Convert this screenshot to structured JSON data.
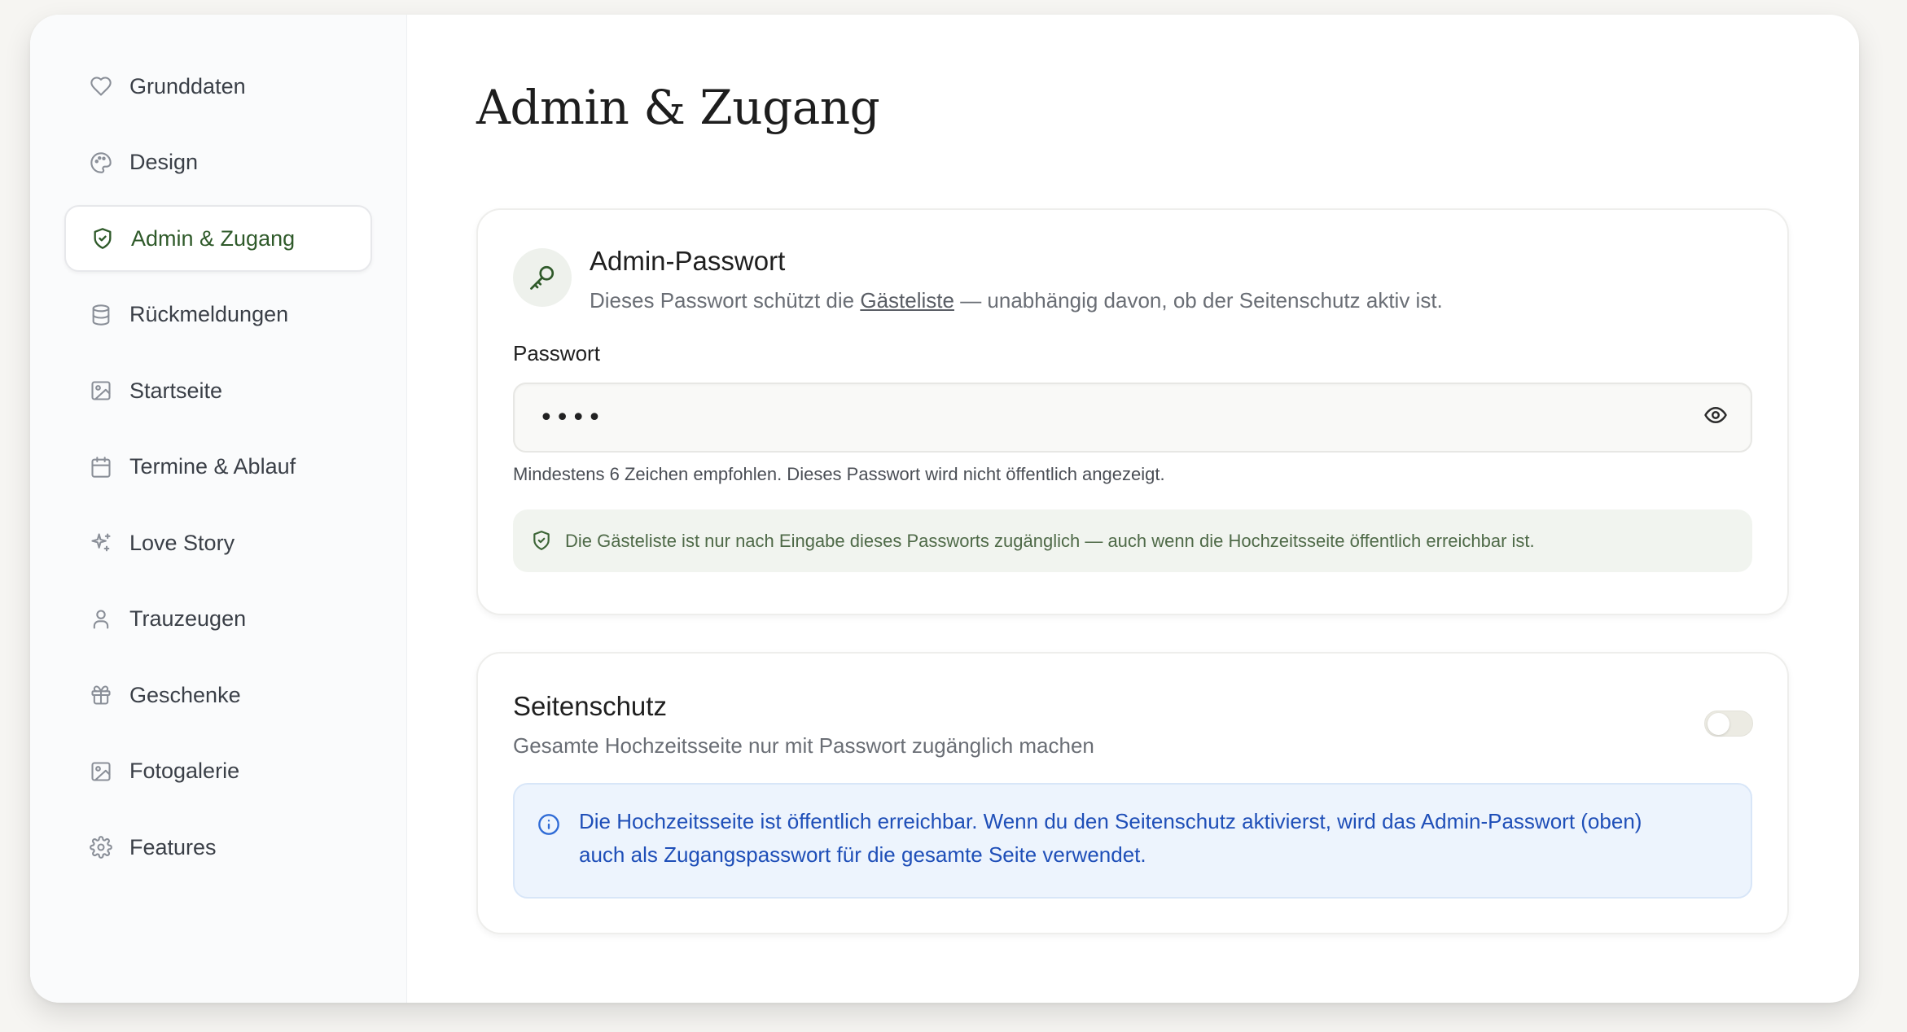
{
  "sidebar": {
    "items": [
      {
        "label": "Grunddaten",
        "icon": "heart-icon"
      },
      {
        "label": "Design",
        "icon": "palette-icon"
      },
      {
        "label": "Admin & Zugang",
        "icon": "shield-check-icon",
        "active": true
      },
      {
        "label": "Rückmeldungen",
        "icon": "database-icon"
      },
      {
        "label": "Startseite",
        "icon": "image-icon"
      },
      {
        "label": "Termine & Ablauf",
        "icon": "calendar-icon"
      },
      {
        "label": "Love Story",
        "icon": "sparkles-icon"
      },
      {
        "label": "Trauzeugen",
        "icon": "user-icon"
      },
      {
        "label": "Geschenke",
        "icon": "gift-icon"
      },
      {
        "label": "Fotogalerie",
        "icon": "image-icon"
      },
      {
        "label": "Features",
        "icon": "gear-icon"
      }
    ]
  },
  "main": {
    "title": "Admin & Zugang",
    "admin_password": {
      "title": "Admin-Passwort",
      "desc_before": "Dieses Passwort schützt die ",
      "desc_link": "Gästeliste",
      "desc_after": " — unabhängig davon, ob der Seitenschutz aktiv ist.",
      "field_label": "Passwort",
      "field_value": "••••",
      "hint": "Mindestens 6 Zeichen empfohlen. Dieses Passwort wird nicht öffentlich angezeigt.",
      "note": "Die Gästeliste ist nur nach Eingabe dieses Passworts zugänglich — auch wenn die Hochzeitsseite öffentlich erreichbar ist."
    },
    "site_protection": {
      "title": "Seitenschutz",
      "desc": "Gesamte Hochzeitsseite nur mit Passwort zugänglich machen",
      "enabled": false,
      "info_line1": "Die Hochzeitsseite ist öffentlich erreichbar. Wenn du den Seitenschutz aktivierst, wird das Admin-Passwort (oben)",
      "info_line2": "auch als Zugangspasswort für die gesamte Seite verwendet."
    }
  },
  "colors": {
    "accent_green": "#2f5a2a",
    "info_blue": "#1f4fb8",
    "info_bg": "#edf4fd"
  }
}
